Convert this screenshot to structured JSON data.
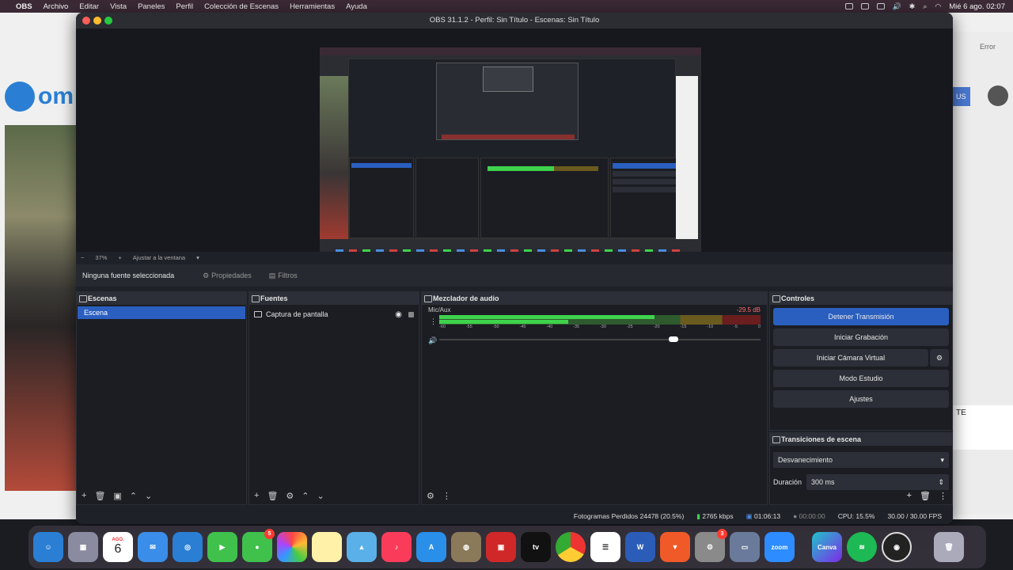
{
  "menubar": {
    "app": "OBS",
    "items": [
      "Archivo",
      "Editar",
      "Vista",
      "Paneles",
      "Perfil",
      "Colección de Escenas",
      "Herramientas",
      "Ayuda"
    ],
    "clock": "Mié 6 ago.  02:07"
  },
  "background_browser": {
    "logo_text": "om",
    "error_text": "Error",
    "blue_text": "US",
    "side_text": "TE"
  },
  "window": {
    "title": "OBS 31.1.2 - Perfil: Sin Título - Escenas: Sin Título"
  },
  "preview": {
    "zoom": "37%",
    "fit_label": "Ajustar a la ventana"
  },
  "context_bar": {
    "no_source": "Ninguna fuente seleccionada",
    "properties": "Propiedades",
    "filters": "Filtros"
  },
  "scenes": {
    "title": "Escenas",
    "items": [
      "Escena"
    ]
  },
  "sources": {
    "title": "Fuentes",
    "items": [
      "Captura de pantalla"
    ]
  },
  "mixer": {
    "title": "Mezclador de audio",
    "channel": "Mic/Aux",
    "db": "-29.5 dB",
    "ticks": [
      "-60",
      "-55",
      "-50",
      "-45",
      "-40",
      "-35",
      "-30",
      "-25",
      "-20",
      "-15",
      "-10",
      "-5",
      "0"
    ],
    "level_fraction": 0.67,
    "volume_fraction": 0.73
  },
  "controls": {
    "title": "Controles",
    "stop_stream": "Detener Transmisión",
    "start_recording": "Iniciar Grabación",
    "virtual_cam": "Iniciar Cámara Virtual",
    "studio_mode": "Modo Estudio",
    "settings": "Ajustes"
  },
  "transitions": {
    "title": "Transiciones de escena",
    "selected": "Desvanecimiento",
    "duration_label": "Duración",
    "duration_value": "300 ms"
  },
  "status": {
    "dropped": "Fotogramas Perdidos 24478 (20.5%)",
    "bitrate": "2765 kbps",
    "stream_time": "01:06:13",
    "rec_time": "00:00:00",
    "cpu": "CPU: 15.5%",
    "fps": "30.00 / 30.00 FPS"
  },
  "dock": {
    "calendar_month": "AGO.",
    "calendar_day": "6",
    "messages_badge": "5",
    "settings_badge": "3",
    "zoom_label": "zoom",
    "canva_label": "Canva",
    "tv_label": "tv"
  }
}
